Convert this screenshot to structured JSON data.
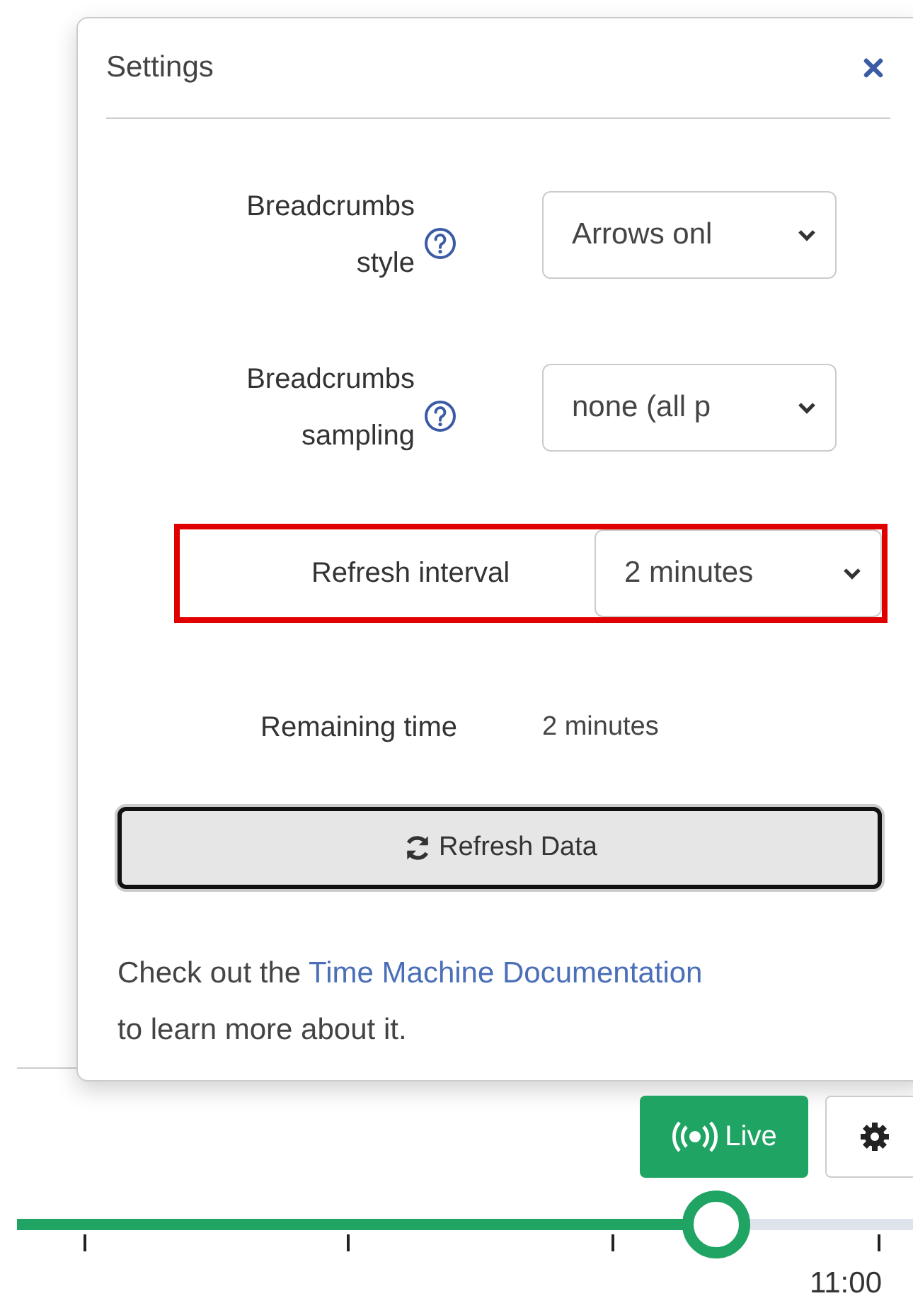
{
  "panel": {
    "title": "Settings"
  },
  "settings": [
    {
      "kind": "select",
      "label": "Breadcrumbs style",
      "help": true,
      "value": "Arrows onl",
      "highlighted": false
    },
    {
      "kind": "select",
      "label": "Breadcrumbs sampling",
      "help": true,
      "value": "none (all p",
      "highlighted": false
    },
    {
      "kind": "select",
      "label": "Refresh interval",
      "help": false,
      "value": "2 minutes",
      "highlighted": true
    },
    {
      "kind": "text",
      "label": "Remaining time",
      "help": false,
      "value": "2 minutes",
      "highlighted": false
    }
  ],
  "refresh_button": "Refresh Data",
  "note": {
    "before": "Check out the",
    "link": "Time Machine Documentation",
    "after": "to learn more about it."
  },
  "live_button": "Live",
  "timeline": {
    "level": 0.78,
    "time_label": "11:00"
  }
}
